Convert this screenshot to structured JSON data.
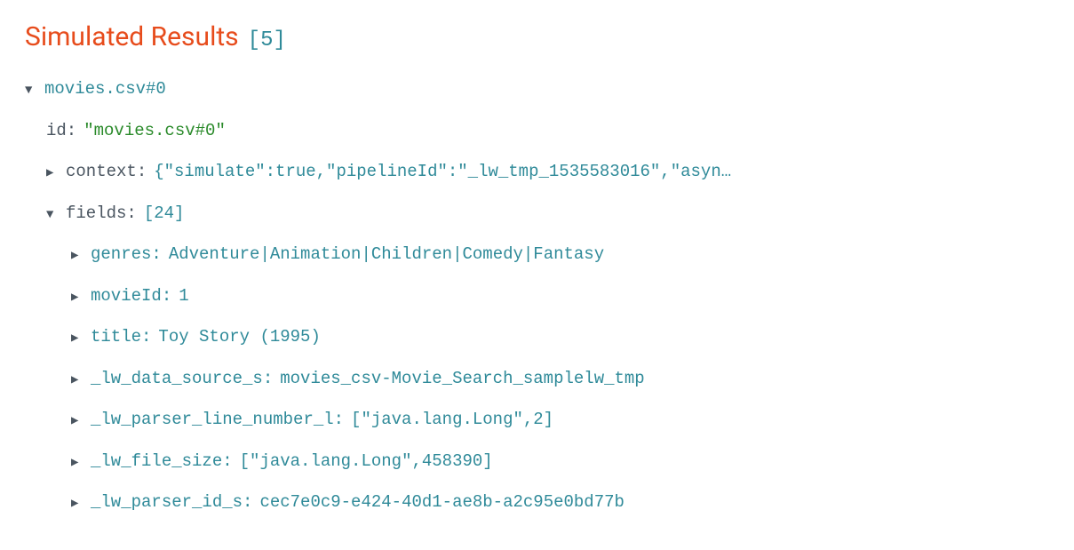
{
  "heading": {
    "title": "Simulated Results",
    "count": "[5]"
  },
  "result": {
    "label": "movies.csv#0",
    "id": {
      "key": "id:",
      "value": "\"movies.csv#0\""
    },
    "context": {
      "key": "context:",
      "preview": "{\"simulate\":true,\"pipelineId\":\"_lw_tmp_1535583016\",\"asyn…"
    },
    "fields": {
      "key": "fields:",
      "count": "[24]",
      "items": [
        {
          "key": "genres:",
          "value": "Adventure|Animation|Children|Comedy|Fantasy"
        },
        {
          "key": "movieId:",
          "value": "1"
        },
        {
          "key": "title:",
          "value": "Toy Story (1995)"
        },
        {
          "key": "_lw_data_source_s:",
          "value": "movies_csv-Movie_Search_samplelw_tmp"
        },
        {
          "key": "_lw_parser_line_number_l:",
          "value": "[\"java.lang.Long\",2]"
        },
        {
          "key": "_lw_file_size:",
          "value": "[\"java.lang.Long\",458390]"
        },
        {
          "key": "_lw_parser_id_s:",
          "value": "cec7e0c9-e424-40d1-ae8b-a2c95e0bd77b"
        }
      ]
    }
  },
  "glyphs": {
    "open": "▼",
    "closed": "▶"
  }
}
